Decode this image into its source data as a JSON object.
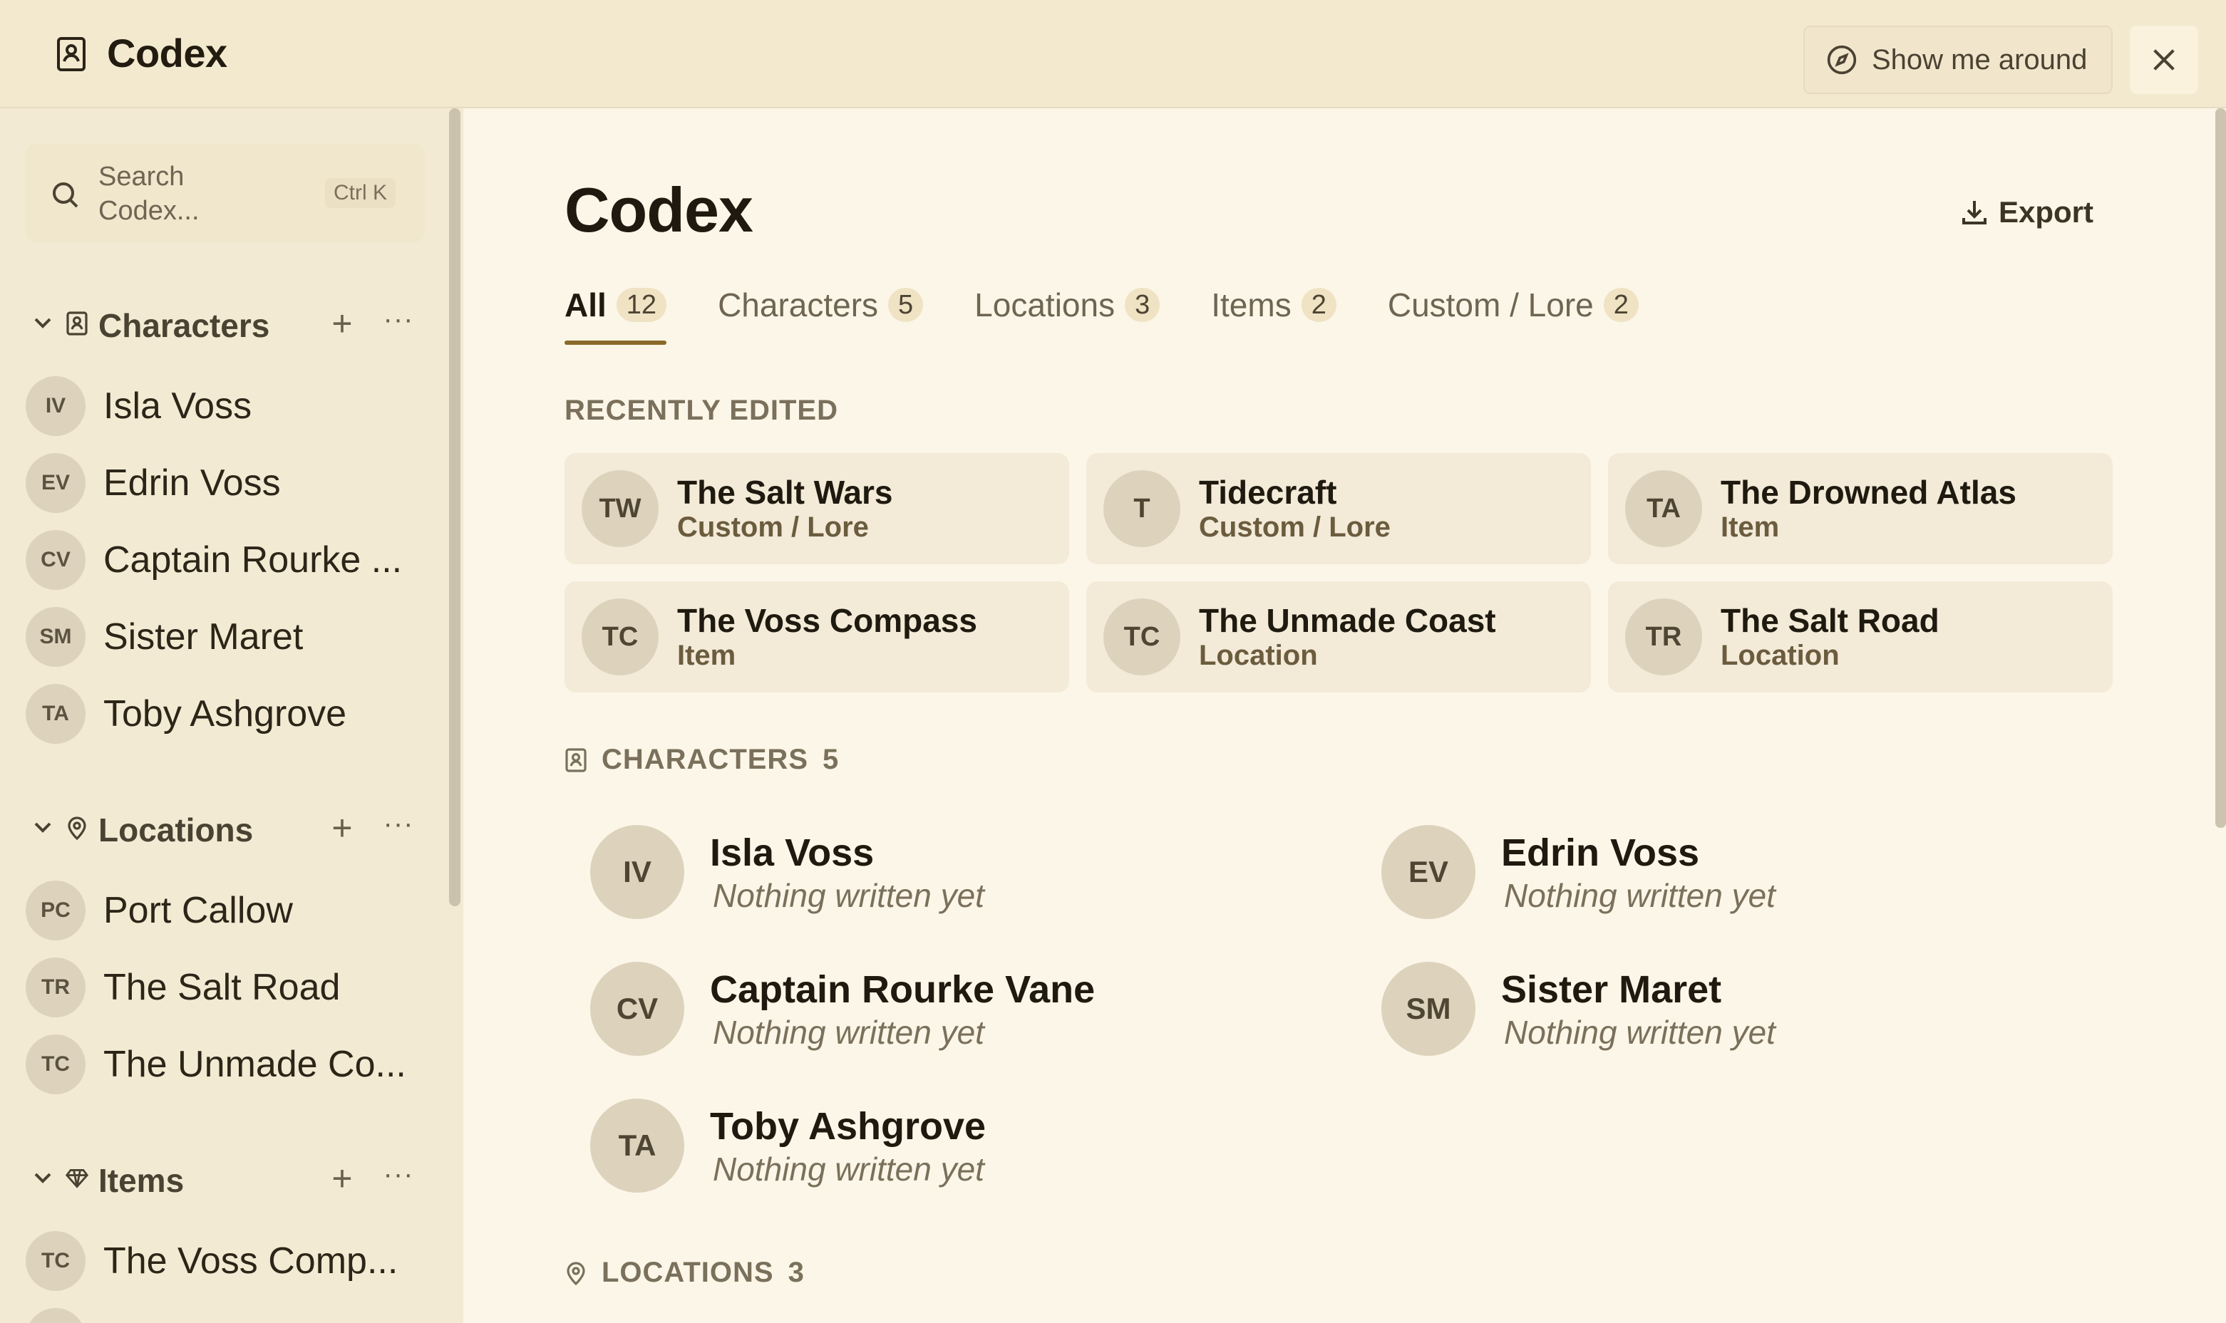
{
  "header": {
    "title": "Codex",
    "tour_label": "Show me around"
  },
  "sidebar": {
    "search_placeholder": "Search Codex...",
    "search_shortcut": "Ctrl K",
    "sections": [
      {
        "label": "Characters",
        "items": [
          {
            "initials": "IV",
            "label": "Isla Voss"
          },
          {
            "initials": "EV",
            "label": "Edrin Voss"
          },
          {
            "initials": "CV",
            "label": "Captain Rourke ..."
          },
          {
            "initials": "SM",
            "label": "Sister Maret"
          },
          {
            "initials": "TA",
            "label": "Toby Ashgrove"
          }
        ]
      },
      {
        "label": "Locations",
        "items": [
          {
            "initials": "PC",
            "label": "Port Callow"
          },
          {
            "initials": "TR",
            "label": "The Salt Road"
          },
          {
            "initials": "TC",
            "label": "The Unmade Co..."
          }
        ]
      },
      {
        "label": "Items",
        "items": [
          {
            "initials": "TC",
            "label": "The Voss Comp..."
          }
        ]
      }
    ]
  },
  "main": {
    "title": "Codex",
    "export_label": "Export",
    "tabs": [
      {
        "label": "All",
        "count": "12"
      },
      {
        "label": "Characters",
        "count": "5"
      },
      {
        "label": "Locations",
        "count": "3"
      },
      {
        "label": "Items",
        "count": "2"
      },
      {
        "label": "Custom / Lore",
        "count": "2"
      }
    ],
    "recent_heading": "RECENTLY EDITED",
    "recent": [
      {
        "initials": "TW",
        "title": "The Salt Wars",
        "type": "Custom / Lore"
      },
      {
        "initials": "T",
        "title": "Tidecraft",
        "type": "Custom / Lore"
      },
      {
        "initials": "TA",
        "title": "The Drowned Atlas",
        "type": "Item"
      },
      {
        "initials": "TC",
        "title": "The Voss Compass",
        "type": "Item"
      },
      {
        "initials": "TC",
        "title": "The Unmade Coast",
        "type": "Location"
      },
      {
        "initials": "TR",
        "title": "The Salt Road",
        "type": "Location"
      }
    ],
    "characters_heading": "CHARACTERS",
    "characters_count": "5",
    "characters": [
      {
        "initials": "IV",
        "name": "Isla Voss",
        "note": "Nothing written yet"
      },
      {
        "initials": "EV",
        "name": "Edrin Voss",
        "note": "Nothing written yet"
      },
      {
        "initials": "CV",
        "name": "Captain Rourke Vane",
        "note": "Nothing written yet"
      },
      {
        "initials": "SM",
        "name": "Sister Maret",
        "note": "Nothing written yet"
      },
      {
        "initials": "TA",
        "name": "Toby Ashgrove",
        "note": "Nothing written yet"
      }
    ],
    "locations_heading": "LOCATIONS",
    "locations_count": "3"
  }
}
